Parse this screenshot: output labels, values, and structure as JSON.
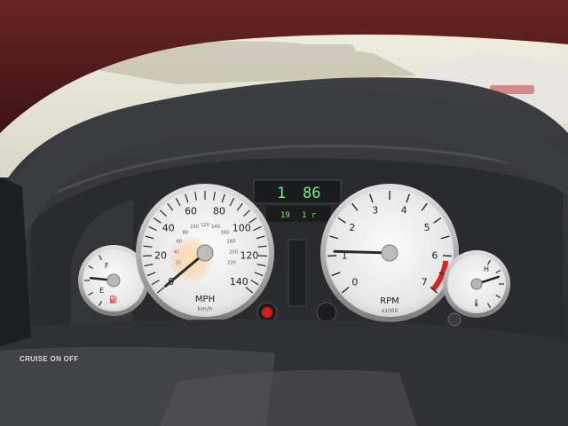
{
  "speedometer": {
    "ticks": [
      "0",
      "20",
      "40",
      "60",
      "80",
      "100",
      "120",
      "140"
    ],
    "inner_ticks": [
      "20",
      "40",
      "60",
      "80",
      "100",
      "120",
      "140",
      "160",
      "180",
      "200",
      "220"
    ],
    "unit": "MPH",
    "subunit": "km/h",
    "needle_fraction": 0.0
  },
  "tachometer": {
    "ticks": [
      "0",
      "1",
      "2",
      "3",
      "4",
      "5",
      "6",
      "7"
    ],
    "unit": "RPM",
    "subunit": "x1000",
    "needle_fraction": 0.16
  },
  "fuel_gauge": {
    "full": "F",
    "empty": "E",
    "needle_fraction": 0.55
  },
  "temp_gauge": {
    "hot": "H",
    "needle_fraction": 0.35
  },
  "display": {
    "gear": "1",
    "readout": "86",
    "bottom_left": "19",
    "bottom_right": "1 r"
  },
  "steering_button": {
    "label": "CRUISE ON OFF"
  },
  "colors": {
    "dash": "#2d2e31",
    "dial_face": "#ececec",
    "lcd": "#7cf08a",
    "warning_red": "#d41c1c",
    "headliner": "#5b1d1d"
  }
}
